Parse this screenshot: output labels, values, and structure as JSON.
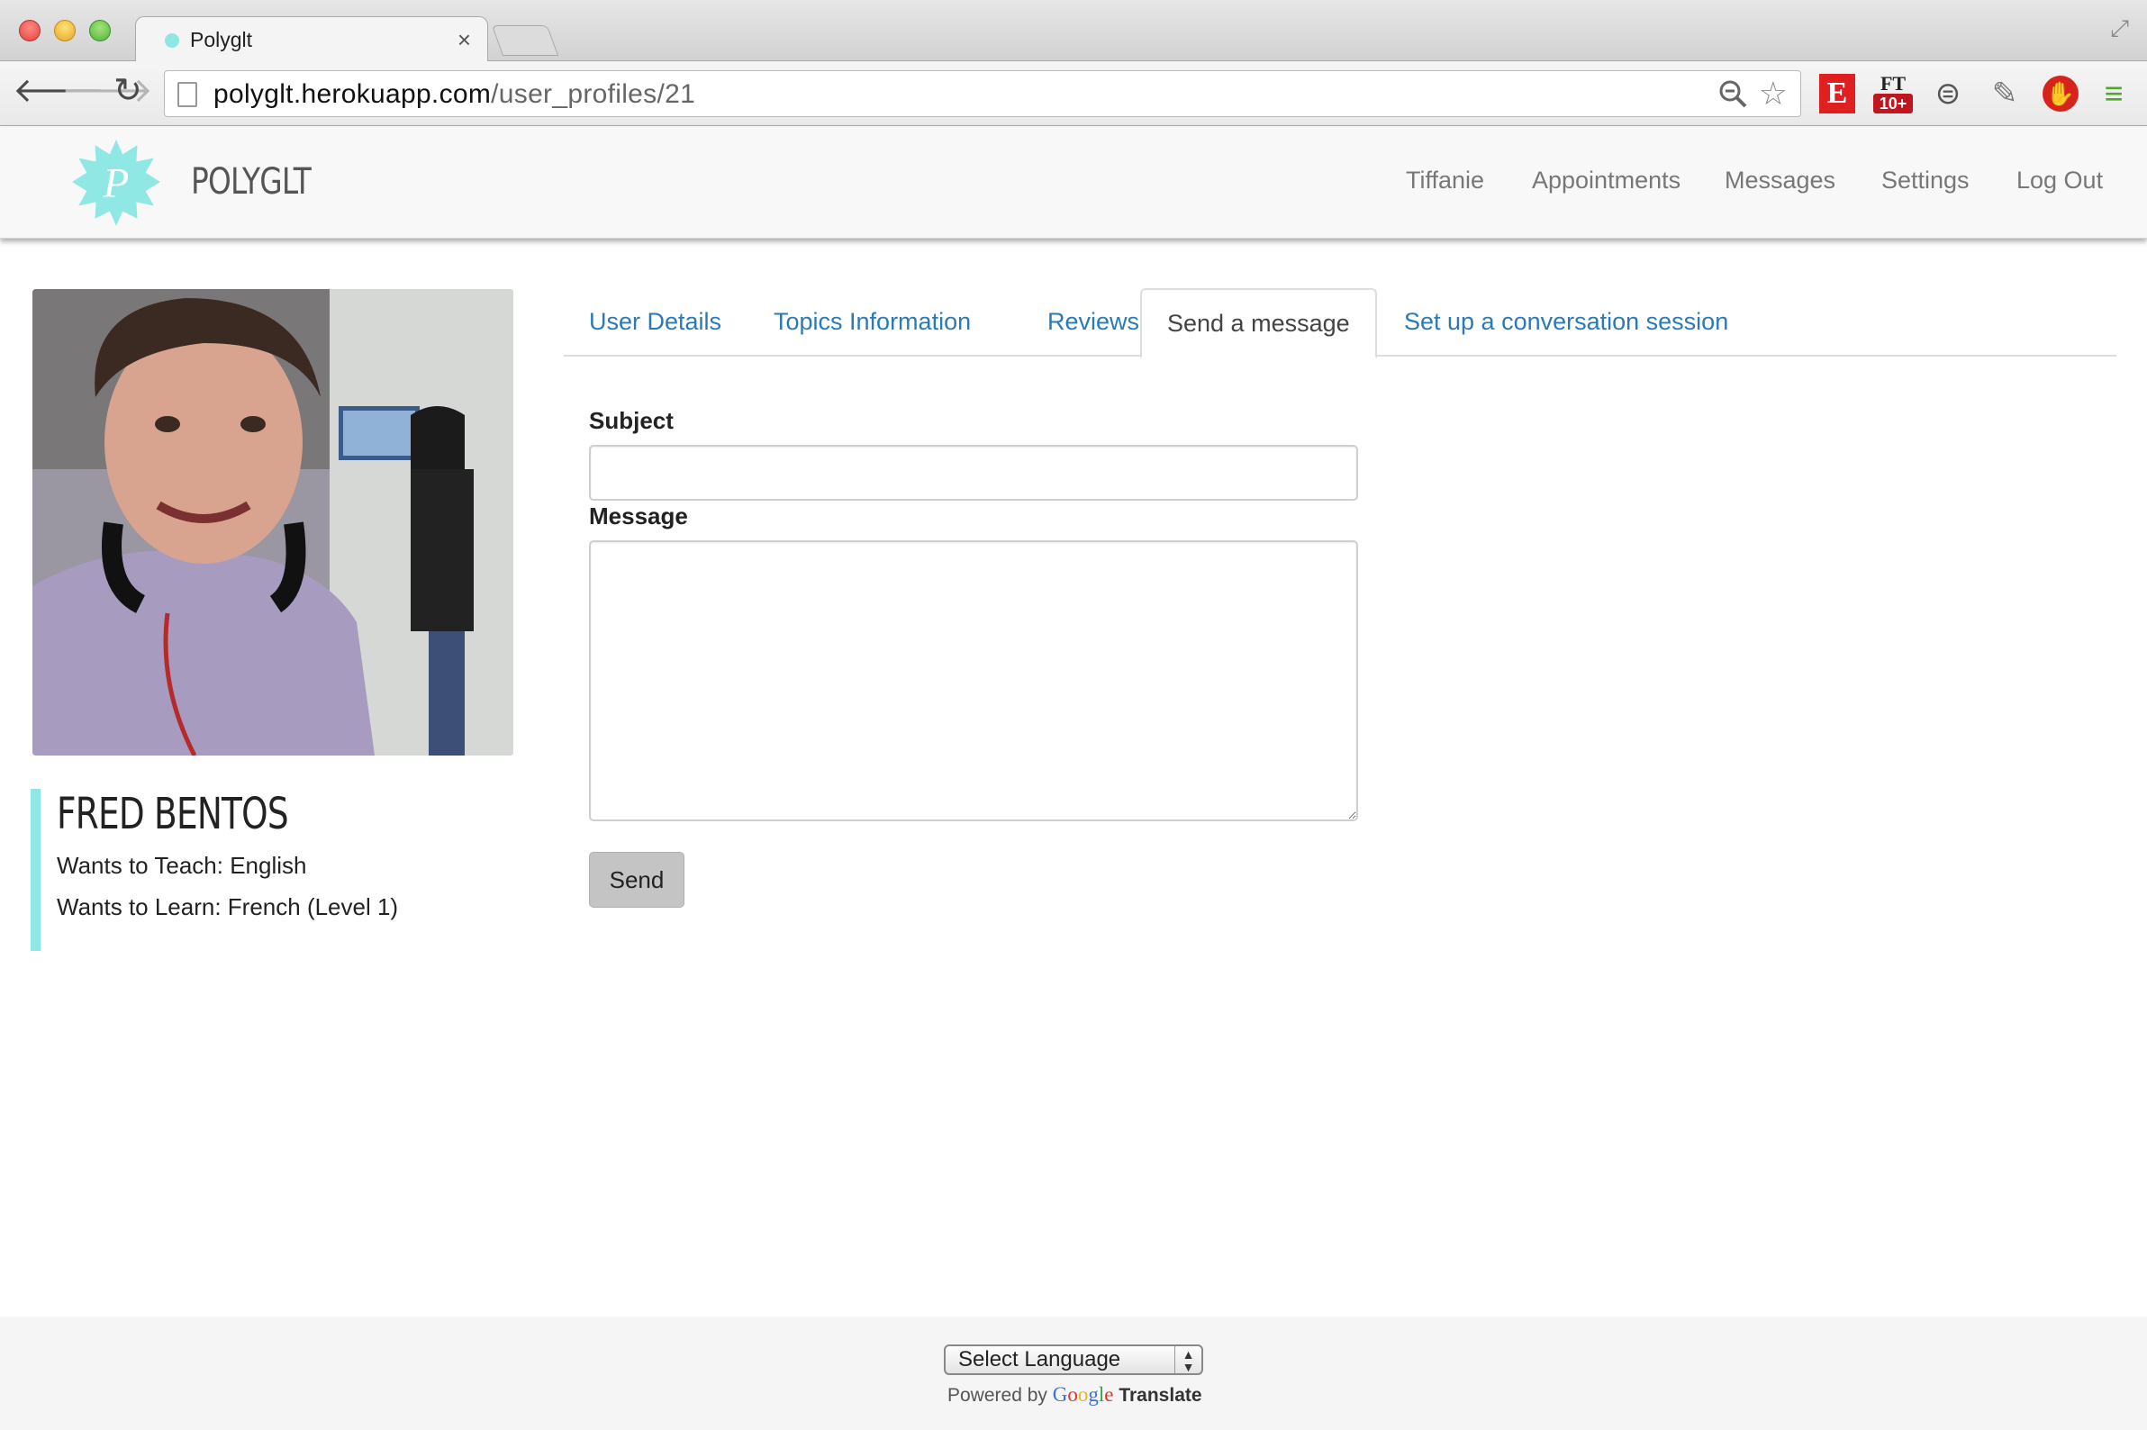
{
  "browser": {
    "tab_title": "Polyglt",
    "tab_close": "×",
    "url_host": "polyglt.herokuapp.com",
    "url_path": "/user_profiles/21",
    "extensions": {
      "e_label": "E",
      "ft_label": "FT",
      "ft_badge": "10+"
    }
  },
  "site": {
    "brand": "POLYGLT",
    "nav": [
      "Tiffanie",
      "Appointments",
      "Messages",
      "Settings",
      "Log Out"
    ],
    "accent_color": "#8fe8e4"
  },
  "profile": {
    "name": "FRED BENTOS",
    "teach": "Wants to Teach: English",
    "learn": "Wants to Learn: French (Level 1)"
  },
  "tabs": {
    "user_details": "User Details",
    "topics": "Topics Information",
    "reviews": "Reviews",
    "send_message": "Send a message",
    "conversation": "Set up a conversation session",
    "active": "Send a message"
  },
  "form": {
    "subject_label": "Subject",
    "subject_value": "",
    "message_label": "Message",
    "message_value": "",
    "send_label": "Send"
  },
  "footer": {
    "select_language": "Select Language",
    "powered_by": "Powered by",
    "google": "Google",
    "translate": "Translate"
  }
}
